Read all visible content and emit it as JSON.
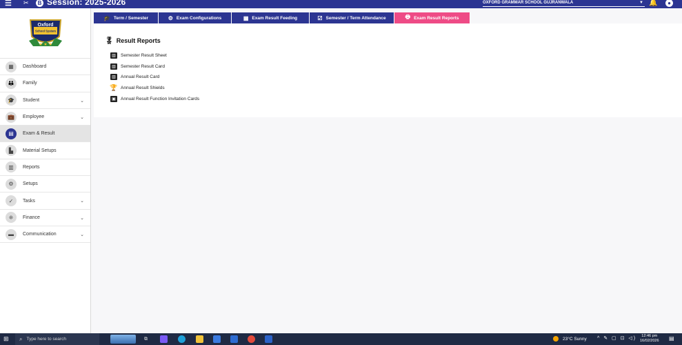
{
  "topbar": {
    "menu_icon": "☰",
    "tools_icon": "✂",
    "session_badge": "B",
    "session_text": "Session: 2025-2026",
    "school_name": "OXFORD GRAMMAR SCHOOL GUJRANWALA",
    "bell_icon": "bell-icon",
    "account_icon": "account-icon"
  },
  "logo": {
    "line1": "Oxford",
    "line2": "School System"
  },
  "sidebar": {
    "items": [
      {
        "label": "Dashboard",
        "icon": "dashboard-icon",
        "glyph": "▦",
        "has_chevron": false
      },
      {
        "label": "Family",
        "icon": "family-icon",
        "glyph": "👪",
        "has_chevron": false
      },
      {
        "label": "Student",
        "icon": "student-icon",
        "glyph": "🎓",
        "has_chevron": true
      },
      {
        "label": "Employee",
        "icon": "employee-icon",
        "glyph": "💼",
        "has_chevron": true
      },
      {
        "label": "Exam & Result",
        "icon": "exam-icon",
        "glyph": "▤",
        "has_chevron": false,
        "active": true
      },
      {
        "label": "Material Setups",
        "icon": "material-icon",
        "glyph": "▙",
        "has_chevron": false
      },
      {
        "label": "Reports",
        "icon": "reports-icon",
        "glyph": "▥",
        "has_chevron": false
      },
      {
        "label": "Setups",
        "icon": "setups-icon",
        "glyph": "⚙",
        "has_chevron": false
      },
      {
        "label": "Tasks",
        "icon": "tasks-icon",
        "glyph": "✓",
        "has_chevron": true
      },
      {
        "label": "Finance",
        "icon": "finance-icon",
        "glyph": "⁜",
        "has_chevron": true
      },
      {
        "label": "Communication",
        "icon": "communication-icon",
        "glyph": "▬",
        "has_chevron": true
      }
    ],
    "chevron": "⌄"
  },
  "tabs": [
    {
      "label": "Term / Semester",
      "glyph": "🎓",
      "width": 94
    },
    {
      "label": "Exam Configurations",
      "glyph": "⚙",
      "width": 106
    },
    {
      "label": "Exam Result Feeding",
      "glyph": "▦",
      "width": 113
    },
    {
      "label": "Semester / Term Attendance",
      "glyph": "☑",
      "width": 123
    },
    {
      "label": "Exam Result Reports",
      "glyph": "🖶",
      "width": 110,
      "active": true
    }
  ],
  "content": {
    "title": "Result Reports",
    "title_glyph": "🎖",
    "items": [
      {
        "label": "Semester Result Sheet",
        "icon": "bar-chart-icon",
        "glyph": "▥"
      },
      {
        "label": "Semester Result Card",
        "icon": "bar-chart-icon",
        "glyph": "▥"
      },
      {
        "label": "Annual Result Card",
        "icon": "bar-chart-icon",
        "glyph": "▥"
      },
      {
        "label": "Annual Result Shields",
        "icon": "trophy-icon",
        "glyph": "🏆"
      },
      {
        "label": "Annual Result Function Invitation Cards",
        "icon": "badge-icon",
        "glyph": "▣"
      }
    ]
  },
  "taskbar": {
    "search_placeholder": "Type here to search",
    "weather": "23°C  Sunny",
    "tray": "^ ✎ ▢ ⊡ ◁)",
    "time": "12:46 pm",
    "date": "16/02/2026"
  }
}
